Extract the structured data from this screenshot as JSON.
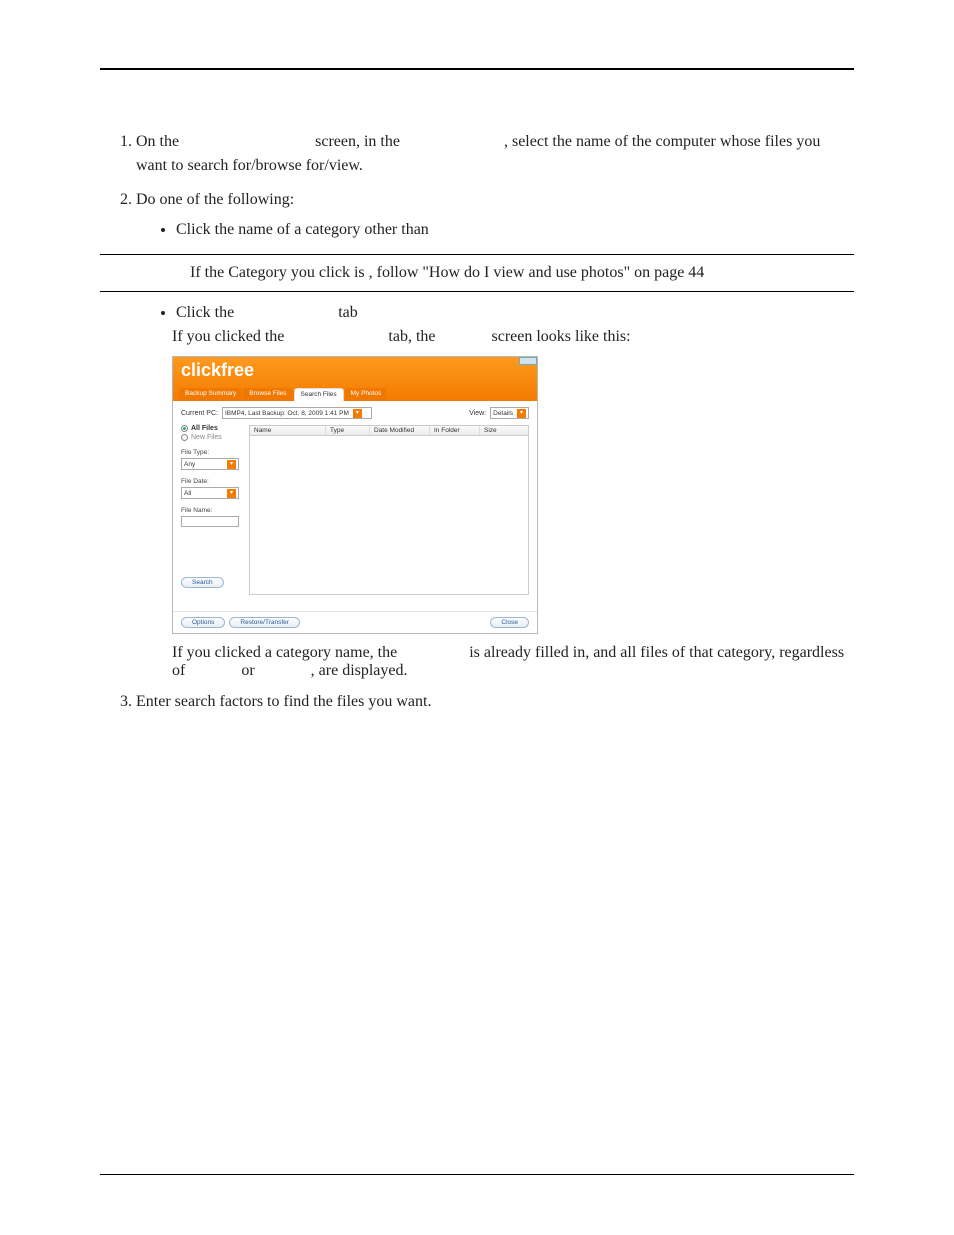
{
  "step1": {
    "pre": "On the",
    "mid1": "screen, in the",
    "mid2": ", select the name of the computer whose files you want to search for/browse for/view."
  },
  "step2": {
    "intro": "Do one of the following:",
    "bullet1": "Click the name of a category other than",
    "callout": "If the Category you click is           , follow \"How do I view and use photos\" on page 44",
    "bullet2_pre": "Click the",
    "bullet2_post": "tab",
    "line_pre": "If you clicked the",
    "line_mid": "tab, the",
    "line_post": "screen looks like this:",
    "after_pre": "If you clicked a category name, the",
    "after_mid": "is already filled in, and all files of that category, regardless of",
    "after_or": "or",
    "after_post": ", are displayed."
  },
  "step3": "Enter search factors to find the files you want.",
  "app": {
    "logo": "clickfree",
    "tabs": [
      "Backup Summary",
      "Browse Files",
      "Search Files",
      "My Photos"
    ],
    "currentPcLabel": "Current PC:",
    "currentPcValue": "IBMP4, Last Backup: Oct. 8, 2009 1:41 PM",
    "viewLabel": "View:",
    "viewValue": "Details",
    "radioAll": "All Files",
    "radioNew": "New Files",
    "fileTypeLabel": "File Type:",
    "fileTypeValue": "Any",
    "fileDateLabel": "File Date:",
    "fileDateValue": "All",
    "fileNameLabel": "File Name:",
    "fileNameValue": "",
    "searchBtn": "Search",
    "cols": [
      "Name",
      "Type",
      "Date Modified",
      "In Folder",
      "Size"
    ],
    "optionsBtn": "Options",
    "restoreBtn": "Restore/Transfer",
    "closeBtn": "Close"
  }
}
